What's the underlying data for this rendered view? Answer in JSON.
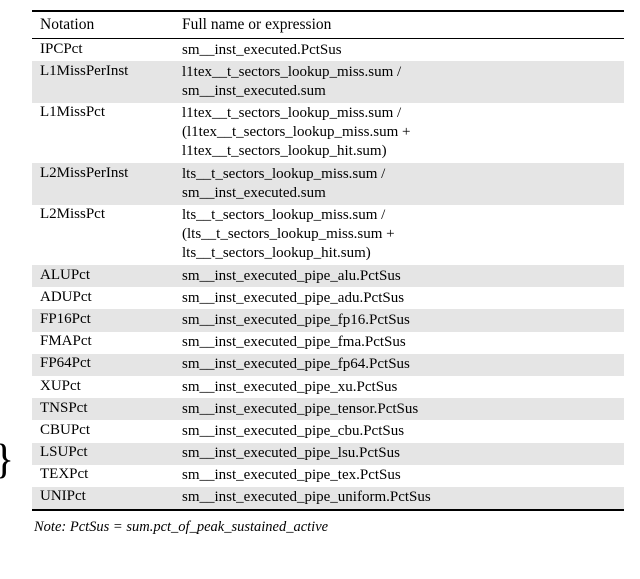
{
  "brace_glyph": "}",
  "header": {
    "col1": "Notation",
    "col2": "Full name or expression"
  },
  "rows": [
    {
      "zebra": false,
      "notation": "IPCPct",
      "expr": "sm__inst_executed.PctSus"
    },
    {
      "zebra": true,
      "notation": "L1MissPerInst",
      "expr": "l1tex__t_sectors_lookup_miss.sum /\nsm__inst_executed.sum"
    },
    {
      "zebra": false,
      "notation": "L1MissPct",
      "expr": "l1tex__t_sectors_lookup_miss.sum /\n(l1tex__t_sectors_lookup_miss.sum +\nl1tex__t_sectors_lookup_hit.sum)"
    },
    {
      "zebra": true,
      "notation": "L2MissPerInst",
      "expr": "lts__t_sectors_lookup_miss.sum /\nsm__inst_executed.sum"
    },
    {
      "zebra": false,
      "notation": "L2MissPct",
      "expr": "lts__t_sectors_lookup_miss.sum /\n(lts__t_sectors_lookup_miss.sum +\nlts__t_sectors_lookup_hit.sum)"
    },
    {
      "zebra": true,
      "notation": "ALUPct",
      "expr": "sm__inst_executed_pipe_alu.PctSus"
    },
    {
      "zebra": false,
      "notation": "ADUPct",
      "expr": "sm__inst_executed_pipe_adu.PctSus"
    },
    {
      "zebra": true,
      "notation": "FP16Pct",
      "expr": "sm__inst_executed_pipe_fp16.PctSus"
    },
    {
      "zebra": false,
      "notation": "FMAPct",
      "expr": "sm__inst_executed_pipe_fma.PctSus"
    },
    {
      "zebra": true,
      "notation": "FP64Pct",
      "expr": "sm__inst_executed_pipe_fp64.PctSus"
    },
    {
      "zebra": false,
      "notation": "XUPct",
      "expr": "sm__inst_executed_pipe_xu.PctSus"
    },
    {
      "zebra": true,
      "notation": "TNSPct",
      "expr": "sm__inst_executed_pipe_tensor.PctSus"
    },
    {
      "zebra": false,
      "notation": "CBUPct",
      "expr": "sm__inst_executed_pipe_cbu.PctSus"
    },
    {
      "zebra": true,
      "notation": "LSUPct",
      "expr": "sm__inst_executed_pipe_lsu.PctSus"
    },
    {
      "zebra": false,
      "notation": "TEXPct",
      "expr": "sm__inst_executed_pipe_tex.PctSus"
    },
    {
      "zebra": true,
      "notation": "UNIPct",
      "expr": "sm__inst_executed_pipe_uniform.PctSus"
    }
  ],
  "note": "Note: PctSus = sum.pct_of_peak_sustained_active"
}
